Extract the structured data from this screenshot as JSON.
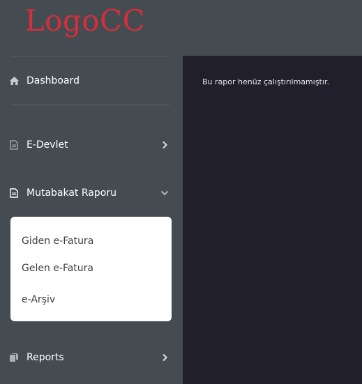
{
  "logo": {
    "text": "LogoCC",
    "color": "#d42f3b"
  },
  "sidebar": {
    "items": [
      {
        "label": "Dashboard",
        "icon": "home-icon"
      },
      {
        "label": "E-Devlet",
        "icon": "document-icon",
        "chevron": "chevron-right-icon"
      },
      {
        "label": "Mutabakat Raporu",
        "icon": "document-icon",
        "chevron": "chevron-down-icon",
        "expanded": true
      },
      {
        "label": "Reports",
        "icon": "copy-icon",
        "chevron": "chevron-right-icon"
      }
    ],
    "submenu": [
      {
        "label": "Giden e-Fatura"
      },
      {
        "label": "Gelen e-Fatura"
      },
      {
        "label": "e-Arşiv"
      }
    ]
  },
  "main": {
    "message": "Bu rapor henüz çalıştırılmamıştır."
  },
  "colors": {
    "sidebar_bg": "#444c52",
    "main_bg": "#221f2c",
    "accent": "#d42f3b"
  }
}
